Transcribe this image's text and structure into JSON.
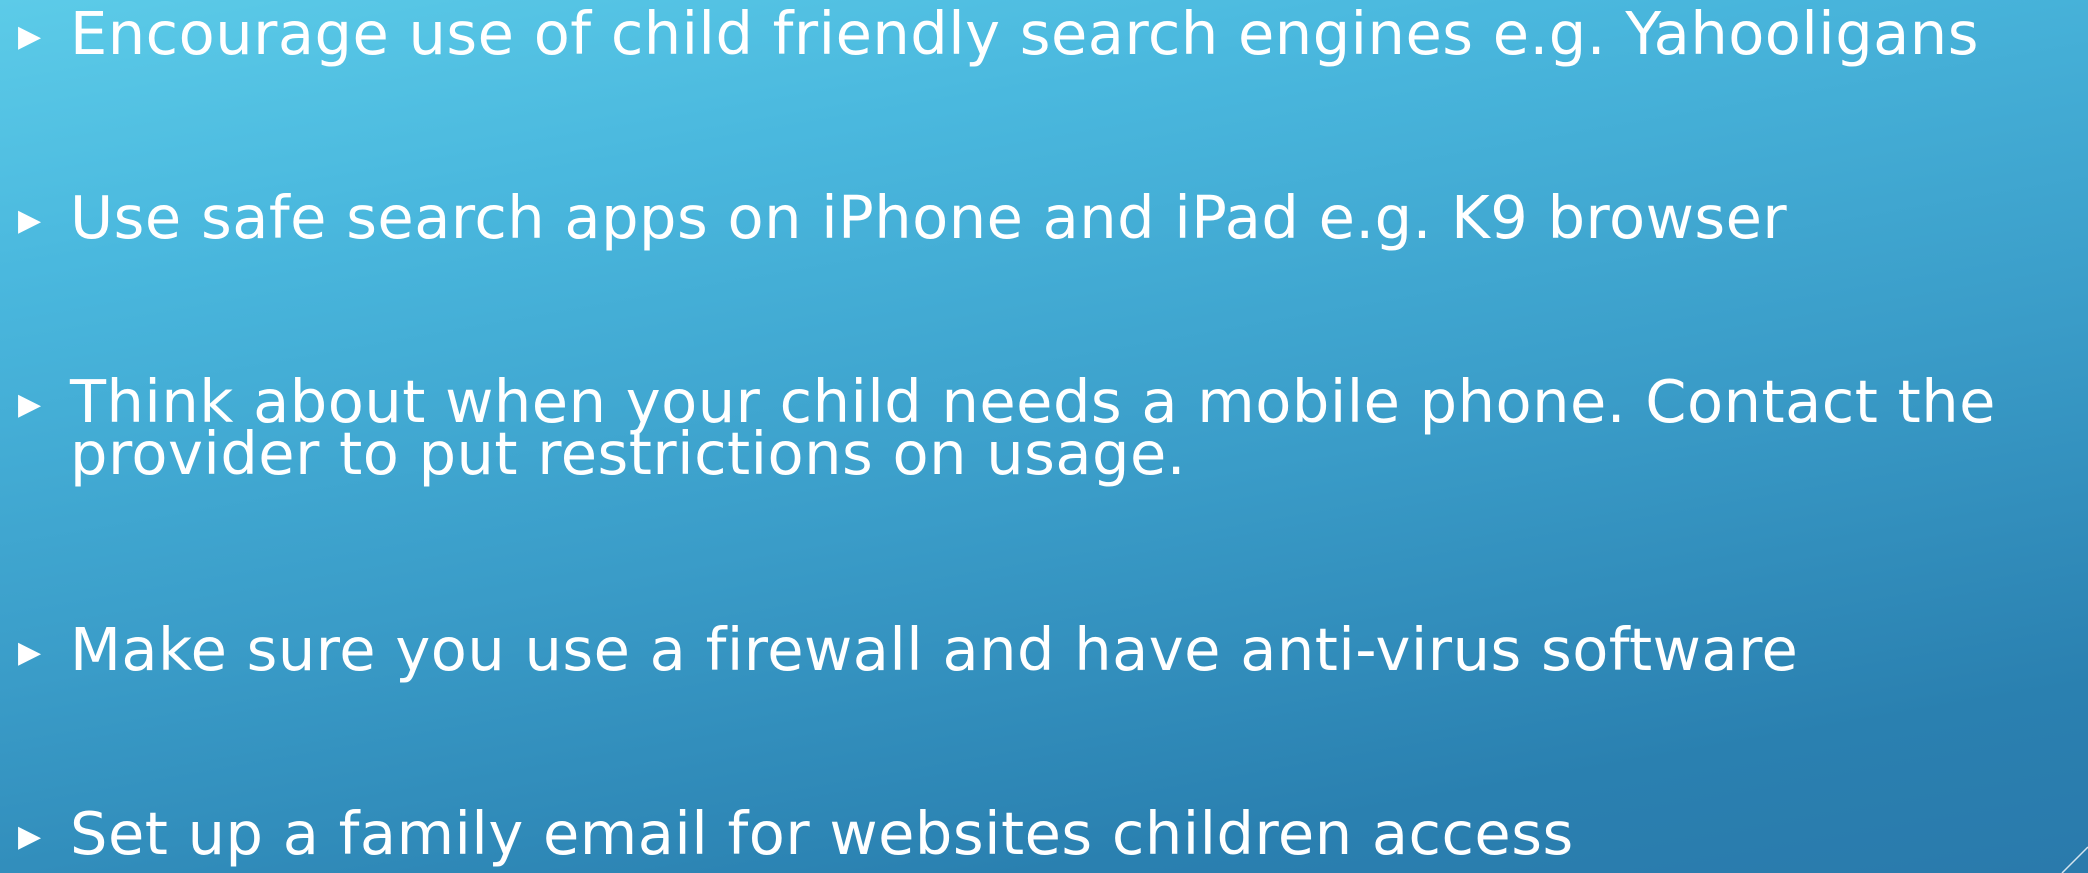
{
  "slide": {
    "bullet_icon": "right-pointing-triangle",
    "text_color": "#ffffff",
    "background_colors": [
      "#5ccbe8",
      "#2a7aac"
    ],
    "bullets": [
      {
        "text": "Encourage use of child friendly search engines e.g. Yahooligans"
      },
      {
        "text": "Use safe search apps on iPhone and iPad e.g. K9 browser"
      },
      {
        "text": "Think about when your child needs a mobile phone. Contact the provider to put restrictions on usage."
      },
      {
        "text": "Make sure you use a firewall and have anti-virus software"
      },
      {
        "text": "Set up a family email for websites children access"
      }
    ]
  }
}
